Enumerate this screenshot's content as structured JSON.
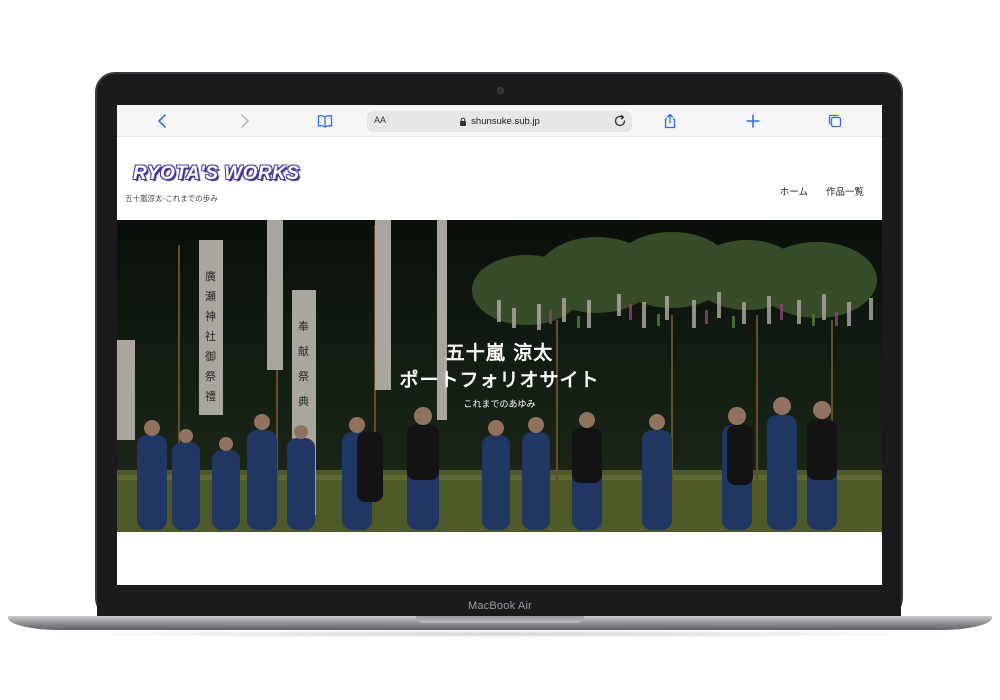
{
  "device": {
    "model_label": "MacBook Air"
  },
  "browser": {
    "font_size_button": "AA",
    "url": "shunsuke.sub.jp",
    "icons": [
      "back-icon",
      "forward-icon",
      "bookmarks-icon",
      "lock-icon",
      "reload-icon",
      "share-icon",
      "new-tab-icon",
      "tabs-icon"
    ]
  },
  "site": {
    "title": "RYOTA'S WORKS",
    "tagline": "五十嵐涼太-これまでの歩み",
    "nav": [
      {
        "label": "ホーム"
      },
      {
        "label": "作品一覧"
      }
    ]
  },
  "hero": {
    "name": "五十嵐 涼太",
    "subtitle": "ポートフォリオサイト",
    "caption": "これまでのあゆみ"
  },
  "colors": {
    "title_outline": "#4a3aa8",
    "icon_blue": "#2f6fe0",
    "laptop_body": "#1b1b1d"
  }
}
